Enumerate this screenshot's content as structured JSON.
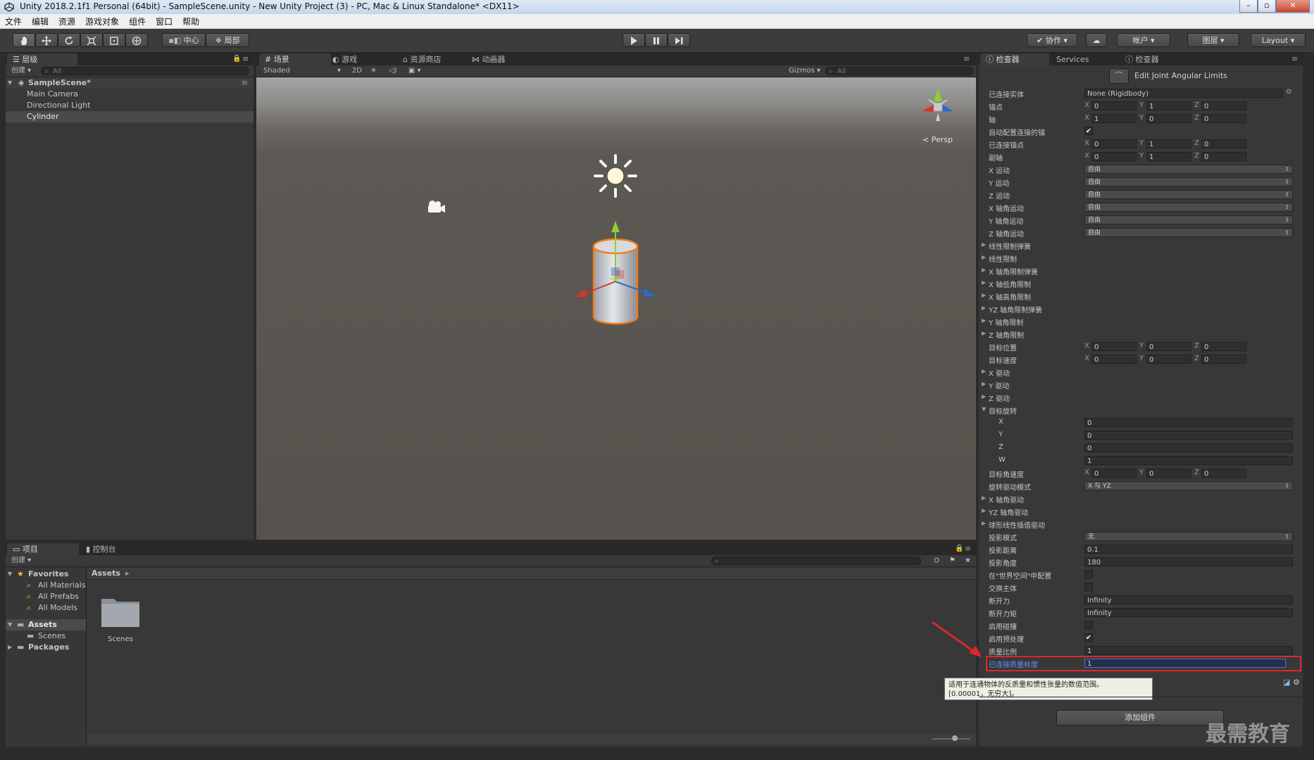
{
  "window": {
    "title": "Unity 2018.2.1f1 Personal (64bit) - SampleScene.unity - New Unity Project (3) - PC, Mac & Linux Standalone* <DX11>"
  },
  "menu": [
    "文件",
    "编辑",
    "资源",
    "游戏对象",
    "组件",
    "窗口",
    "帮助"
  ],
  "toolbar": {
    "pivot": "中心",
    "space": "局部",
    "collab": "协作",
    "account": "帐户",
    "layers": "图层",
    "layout": "Layout"
  },
  "hierarchy": {
    "tab": "层级",
    "create": "创建",
    "search_placeholder": "All",
    "scene": "SampleScene*",
    "items": [
      "Main Camera",
      "Directional Light",
      "Cylinder"
    ],
    "selected": "Cylinder"
  },
  "scene_view": {
    "tabs": [
      "场景",
      "游戏",
      "资源商店",
      "动画器"
    ],
    "shading": "Shaded",
    "mode_2d": "2D",
    "gizmos": "Gizmos",
    "search_placeholder": "All",
    "projection": "Persp"
  },
  "project": {
    "tabs": [
      "项目",
      "控制台"
    ],
    "create": "创建",
    "favorites_label": "Favorites",
    "favorites": [
      "All Materials",
      "All Prefabs",
      "All Models"
    ],
    "assets_label": "Assets",
    "assets_children": [
      "Scenes"
    ],
    "packages_label": "Packages",
    "breadcrumb": "Assets",
    "folders": [
      "Scenes"
    ]
  },
  "inspector": {
    "tabs": [
      "检查器",
      "Services",
      "检查器"
    ],
    "edit_limits": "Edit Joint Angular Limits",
    "rows": [
      {
        "label": "已连接实体",
        "type": "object",
        "value": "None (Rigidbody)"
      },
      {
        "label": "锚点",
        "type": "vec3",
        "x": "0",
        "y": "1",
        "z": "0"
      },
      {
        "label": "轴",
        "type": "vec3",
        "x": "1",
        "y": "0",
        "z": "0"
      },
      {
        "label": "自动配置连接的锚",
        "type": "check",
        "checked": true
      },
      {
        "label": "已连接锚点",
        "type": "vec3",
        "x": "0",
        "y": "1",
        "z": "0"
      },
      {
        "label": "副轴",
        "type": "vec3",
        "x": "0",
        "y": "1",
        "z": "0"
      },
      {
        "label": "X 运动",
        "type": "dropdown",
        "value": "自由"
      },
      {
        "label": "Y 运动",
        "type": "dropdown",
        "value": "自由"
      },
      {
        "label": "Z 运动",
        "type": "dropdown",
        "value": "自由"
      },
      {
        "label": "X 轴角运动",
        "type": "dropdown",
        "value": "自由"
      },
      {
        "label": "Y 轴角运动",
        "type": "dropdown",
        "value": "自由"
      },
      {
        "label": "Z 轴角运动",
        "type": "dropdown",
        "value": "自由"
      },
      {
        "label": "线性限制弹簧",
        "type": "fold"
      },
      {
        "label": "线性限制",
        "type": "fold"
      },
      {
        "label": "X 轴角限制弹簧",
        "type": "fold"
      },
      {
        "label": "X 轴低角限制",
        "type": "fold"
      },
      {
        "label": "X 轴高角限制",
        "type": "fold"
      },
      {
        "label": "YZ 轴角限制弹簧",
        "type": "fold"
      },
      {
        "label": "Y 轴角限制",
        "type": "fold"
      },
      {
        "label": "Z 轴角限制",
        "type": "fold"
      },
      {
        "label": "目标位置",
        "type": "vec3",
        "x": "0",
        "y": "0",
        "z": "0"
      },
      {
        "label": "目标速度",
        "type": "vec3",
        "x": "0",
        "y": "0",
        "z": "0"
      },
      {
        "label": "X 驱动",
        "type": "fold"
      },
      {
        "label": "Y 驱动",
        "type": "fold"
      },
      {
        "label": "Z 驱动",
        "type": "fold"
      },
      {
        "label": "目标旋转",
        "type": "foldopen"
      },
      {
        "label": "X",
        "type": "sub",
        "value": "0"
      },
      {
        "label": "Y",
        "type": "sub",
        "value": "0"
      },
      {
        "label": "Z",
        "type": "sub",
        "value": "0"
      },
      {
        "label": "W",
        "type": "sub",
        "value": "1"
      },
      {
        "label": "目标角速度",
        "type": "vec3",
        "x": "0",
        "y": "0",
        "z": "0"
      },
      {
        "label": "旋转驱动模式",
        "type": "dropdown",
        "value": "X 与 YZ"
      },
      {
        "label": "X 轴角驱动",
        "type": "fold"
      },
      {
        "label": "YZ 轴角驱动",
        "type": "fold"
      },
      {
        "label": "球形线性插值驱动",
        "type": "fold"
      },
      {
        "label": "投影模式",
        "type": "dropdown",
        "value": "无"
      },
      {
        "label": "投影距离",
        "type": "text",
        "value": "0.1"
      },
      {
        "label": "投影角度",
        "type": "text",
        "value": "180"
      },
      {
        "label": "在\"世界空间\"中配置",
        "type": "check",
        "checked": false
      },
      {
        "label": "交换主体",
        "type": "check",
        "checked": false
      },
      {
        "label": "断开力",
        "type": "text",
        "value": "Infinity"
      },
      {
        "label": "断开力矩",
        "type": "text",
        "value": "Infinity"
      },
      {
        "label": "启用碰撞",
        "type": "check",
        "checked": false
      },
      {
        "label": "启用预处理",
        "type": "check",
        "checked": true
      },
      {
        "label": "质量比例",
        "type": "text",
        "value": "1"
      },
      {
        "label": "已连接质量标度",
        "type": "text",
        "value": "1",
        "highlight": true
      }
    ],
    "tooltip_line1": "适用于连通物体的反质量和惯性张量的数值范围。",
    "tooltip_line2": "[0.00001，无穷大]。",
    "add_component": "添加组件"
  },
  "colors": {
    "highlight_border": "#e0262b",
    "highlight_label": "#5f8fff",
    "scene_ground": "#5a5550"
  },
  "watermark": "最需教育"
}
